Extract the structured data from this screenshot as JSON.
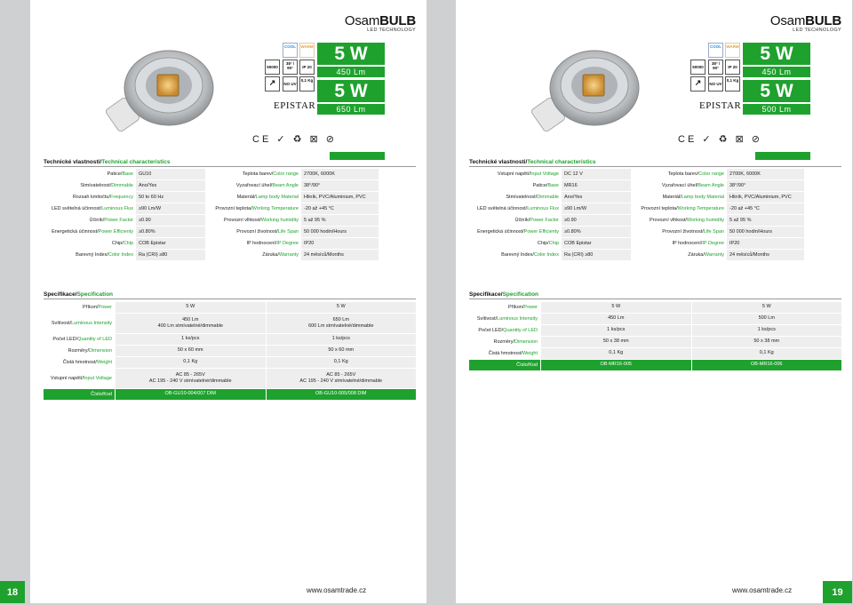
{
  "brand": {
    "name_light": "Osam",
    "name_bold": "BULB",
    "subtitle": "LED TECHNOLOGY"
  },
  "colors": {
    "green": "#1fa12e",
    "cool": "#2a8fd6",
    "warm": "#e6a12a"
  },
  "icons": {
    "cool": "COOL",
    "warm": "WARM",
    "hours": "50000",
    "angle": "38° / 90°",
    "ip": "IP 20",
    "dim": "dimmable-icon",
    "nouv": "NO UV",
    "weight": "0,1 Kg"
  },
  "chip_brand": "EPISTAR",
  "certs": "CE ✓ ♻ ⊠ ⊘",
  "section_tech_cz": "Technické vlastnosti/",
  "section_tech_en": "Technical characteristics",
  "section_spec_cz": "Specifikace/",
  "section_spec_en": "Specification",
  "left": {
    "boxes": [
      {
        "w": "5 W",
        "lm": "450 Lm"
      },
      {
        "w": "5 W",
        "lm": "650 Lm"
      }
    ],
    "tech": [
      [
        [
          "Patice/",
          "Base"
        ],
        "GU10",
        [
          "Teplota barev/",
          "Color range"
        ],
        "2700K, 6000K"
      ],
      [
        [
          "Stmívatelnost/",
          "Dimmable"
        ],
        "Ano/Yes",
        [
          "Vyzařovací úhel/",
          "Beam Angle"
        ],
        "38°/90°"
      ],
      [
        [
          "Rozsah kmitočtu/",
          "Frequency"
        ],
        "50 to 60 Hz",
        [
          "Materiál/",
          "Lamp body Material"
        ],
        "Hliník, PVC/Aluminium, PVC"
      ],
      [
        [
          "LED světelná účinnost/",
          "Luminous Flux"
        ],
        "≥90 Lm/W",
        [
          "Provozní teplota/",
          "Working Temperature"
        ],
        "-20 až +45 °C"
      ],
      [
        [
          "Účiník/",
          "Power Factor"
        ],
        "≥0.90",
        [
          "Provozní vlhkost/",
          "Working humidity"
        ],
        "5 až 95 %"
      ],
      [
        [
          "Energetická účinnost/",
          "Power Efficienty"
        ],
        "≥0.80%",
        [
          "Provozní životnost/",
          "Life Span"
        ],
        "50 000 hodin/Hours"
      ],
      [
        [
          "Chip/",
          "Chip"
        ],
        "COB Epistar",
        [
          "IP hodnocení/",
          "IP Degree"
        ],
        "IP20"
      ],
      [
        [
          "Barevný Index/",
          "Color Index"
        ],
        "Ra (CRI) ≥80",
        [
          "Záruka/",
          "Warranty"
        ],
        "24 měsíců/Months"
      ]
    ],
    "spec": [
      {
        "l": [
          "Příkon/",
          "Power"
        ],
        "v": [
          [
            "5 W"
          ],
          [
            "5 W"
          ]
        ],
        "h": 12
      },
      {
        "l": [
          "Svítivost/",
          "Luminous Intensity"
        ],
        "v": [
          [
            "450 Lm",
            "400 Lm stmívatelné/dimmable"
          ],
          [
            "650 Lm",
            "600 Lm stmívatelné/dimmable"
          ]
        ],
        "h": 22
      },
      {
        "l": [
          "Počet LED/",
          "Quantity of LED"
        ],
        "v": [
          [
            "1 ks/pcs"
          ],
          [
            "1 ks/pcs"
          ]
        ],
        "h": 12
      },
      {
        "l": [
          "Rozměry/",
          "Dimension"
        ],
        "v": [
          [
            "50 x 60 mm"
          ],
          [
            "50 x 60 mm"
          ]
        ],
        "h": 12
      },
      {
        "l": [
          "Čistá hmotnost/",
          "Weight"
        ],
        "v": [
          [
            "0,1 Kg"
          ],
          [
            "0,1 Kg"
          ]
        ],
        "h": 12
      },
      {
        "l": [
          "Vstupní napětí/",
          "Input Voltage"
        ],
        "v": [
          [
            "AC 85 - 265V",
            "AC 195 - 240 V stmívatelné/dimmable"
          ],
          [
            "AC 85 - 265V",
            "AC 195 - 240 V stmívatelné/dimmable"
          ]
        ],
        "h": 22
      },
      {
        "l": [
          "Číslo/Kod",
          ""
        ],
        "v": [
          [
            "OB-GU10-004/007 DIM"
          ],
          [
            "OB-GU10-005/008 DIM"
          ]
        ],
        "h": 12,
        "code": true
      }
    ],
    "url": "www.osamtrade.cz",
    "page": "18"
  },
  "right": {
    "boxes": [
      {
        "w": "5 W",
        "lm": "450 Lm"
      },
      {
        "w": "5 W",
        "lm": "500 Lm"
      }
    ],
    "tech": [
      [
        [
          "Vstupní napětí/",
          "Input Voltage"
        ],
        "DC 12 V",
        [
          "Teplota barev/",
          "Color range"
        ],
        "2700K, 6000K"
      ],
      [
        [
          "Patice/",
          "Base"
        ],
        "MR16",
        [
          "Vyzařovací úhel/",
          "Beam Angle"
        ],
        "38°/90°"
      ],
      [
        [
          "Stmívatelnost/",
          "Dimmable"
        ],
        "Ano/Yes",
        [
          "Materiál/",
          "Lamp body Material"
        ],
        "Hliník, PVC/Aluminium, PVC"
      ],
      [
        [
          "LED světelná účinnost/",
          "Luminous Flux"
        ],
        "≥90 Lm/W",
        [
          "Provozní teplota/",
          "Working Temperature"
        ],
        "-20 až +45 °C"
      ],
      [
        [
          "Účiník/",
          "Power Factor"
        ],
        "≥0.90",
        [
          "Provozní vlhkost/",
          "Working humidity"
        ],
        "5 až 95 %"
      ],
      [
        [
          "Energetická účinnost/",
          "Power Efficienty"
        ],
        "≥0.80%",
        [
          "Provozní životnost/",
          "Life Span"
        ],
        "50 000 hodin/Hours"
      ],
      [
        [
          "Chip/",
          "Chip"
        ],
        "COB Epistar",
        [
          "IP hodnocení/",
          "IP Degree"
        ],
        "IP20"
      ],
      [
        [
          "Barevný Index/",
          "Color Index"
        ],
        "Ra (CRI) ≥80",
        [
          "Záruka/",
          "Warranty"
        ],
        "24 měsíců/Months"
      ]
    ],
    "spec": [
      {
        "l": [
          "Příkon/",
          "Power"
        ],
        "v": [
          [
            "5 W"
          ],
          [
            "5 W"
          ]
        ],
        "h": 12
      },
      {
        "l": [
          "Svítivost/",
          "Luminous Intensity"
        ],
        "v": [
          [
            "450 Lm"
          ],
          [
            "500 Lm"
          ]
        ],
        "h": 12
      },
      {
        "l": [
          "Počet LED/",
          "Quantity of LED"
        ],
        "v": [
          [
            "1 ks/pcs"
          ],
          [
            "1 ks/pcs"
          ]
        ],
        "h": 12
      },
      {
        "l": [
          "Rozměry/",
          "Dimension"
        ],
        "v": [
          [
            "50 x 38 mm"
          ],
          [
            "50 x 38 mm"
          ]
        ],
        "h": 12
      },
      {
        "l": [
          "Čistá hmotnost/",
          "Weight"
        ],
        "v": [
          [
            "0,1 Kg"
          ],
          [
            "0,1 Kg"
          ]
        ],
        "h": 12
      },
      {
        "l": [
          "Číslo/Kod",
          ""
        ],
        "v": [
          [
            "OB-MR16-005"
          ],
          [
            "OB-MR16-006"
          ]
        ],
        "h": 12,
        "code": true
      }
    ],
    "url": "www.osamtrade.cz",
    "page": "19"
  }
}
